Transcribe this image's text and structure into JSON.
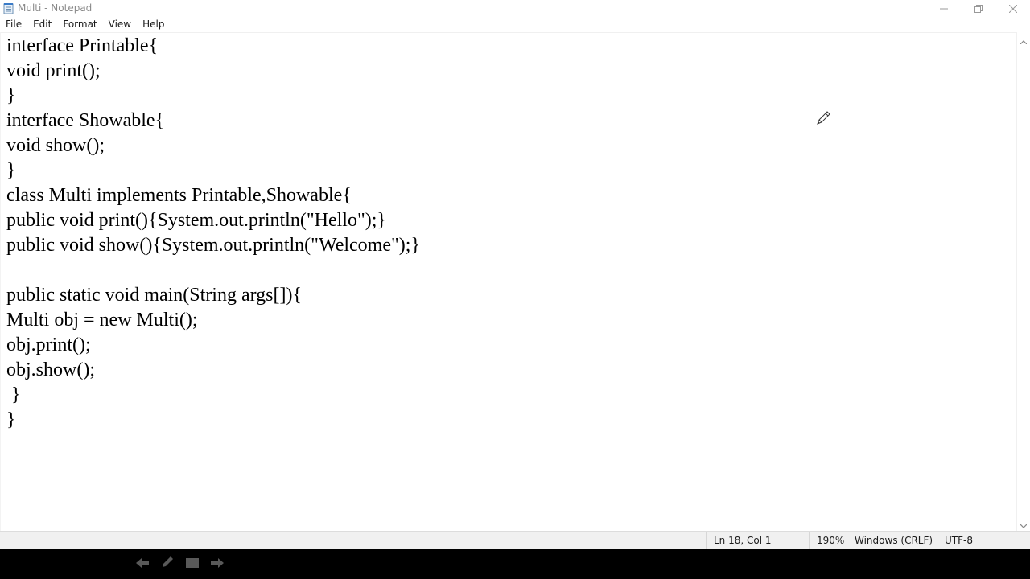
{
  "window": {
    "title": "Multi - Notepad",
    "controls": [
      "minimize-icon",
      "restore-icon",
      "close-icon"
    ]
  },
  "menu": {
    "items": [
      "File",
      "Edit",
      "Format",
      "View",
      "Help"
    ]
  },
  "editor": {
    "lines": [
      "interface Printable{",
      "void print();",
      "}",
      "interface Showable{",
      "void show();",
      "}",
      "class Multi implements Printable,Showable{",
      "public void print(){System.out.println(\"Hello\");}",
      "public void show(){System.out.println(\"Welcome\");}",
      "",
      "public static void main(String args[]){",
      "Multi obj = new Multi();",
      "obj.print();",
      "obj.show();",
      " }",
      "}"
    ]
  },
  "status": {
    "position": "Ln 18, Col 1",
    "zoom": "190%",
    "line_ending": "Windows (CRLF)",
    "encoding": "UTF-8"
  },
  "player": {
    "icons": [
      "back-arrow-icon",
      "pen-icon",
      "screen-icon",
      "forward-arrow-icon"
    ]
  }
}
